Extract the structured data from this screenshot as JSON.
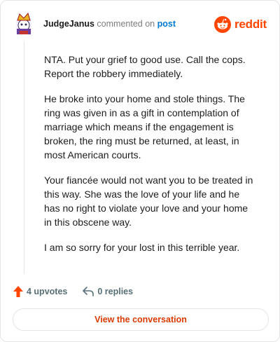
{
  "header": {
    "username": "JudgeJanus",
    "verb": "commented on",
    "target": "post",
    "brand": "reddit"
  },
  "comment": {
    "paragraphs": [
      "NTA. Put your grief to good use. Call the cops. Report the robbery immediately.",
      "He broke into your home and stole things. The ring was given in as a gift in contemplation of marriage which means if the engagement is broken, the ring must be returned, at least, in most American courts.",
      "Your fiancée would not want you to be treated in this way. She was the love of your life and he has no right to violate your love and your home in this obscene way.",
      "I am so sorry for your lost in this terrible year."
    ]
  },
  "actions": {
    "upvotes": "4 upvotes",
    "replies": "0 replies"
  },
  "cta": {
    "label": "View the conversation"
  },
  "icons": {
    "upvote": "upvote-arrow-icon",
    "reply": "reply-arrow-icon",
    "logo": "reddit-snoo-icon"
  },
  "colors": {
    "brand": "#ff4500",
    "link": "#0079d3",
    "cta_text": "#d93a00",
    "muted": "#576f76"
  }
}
